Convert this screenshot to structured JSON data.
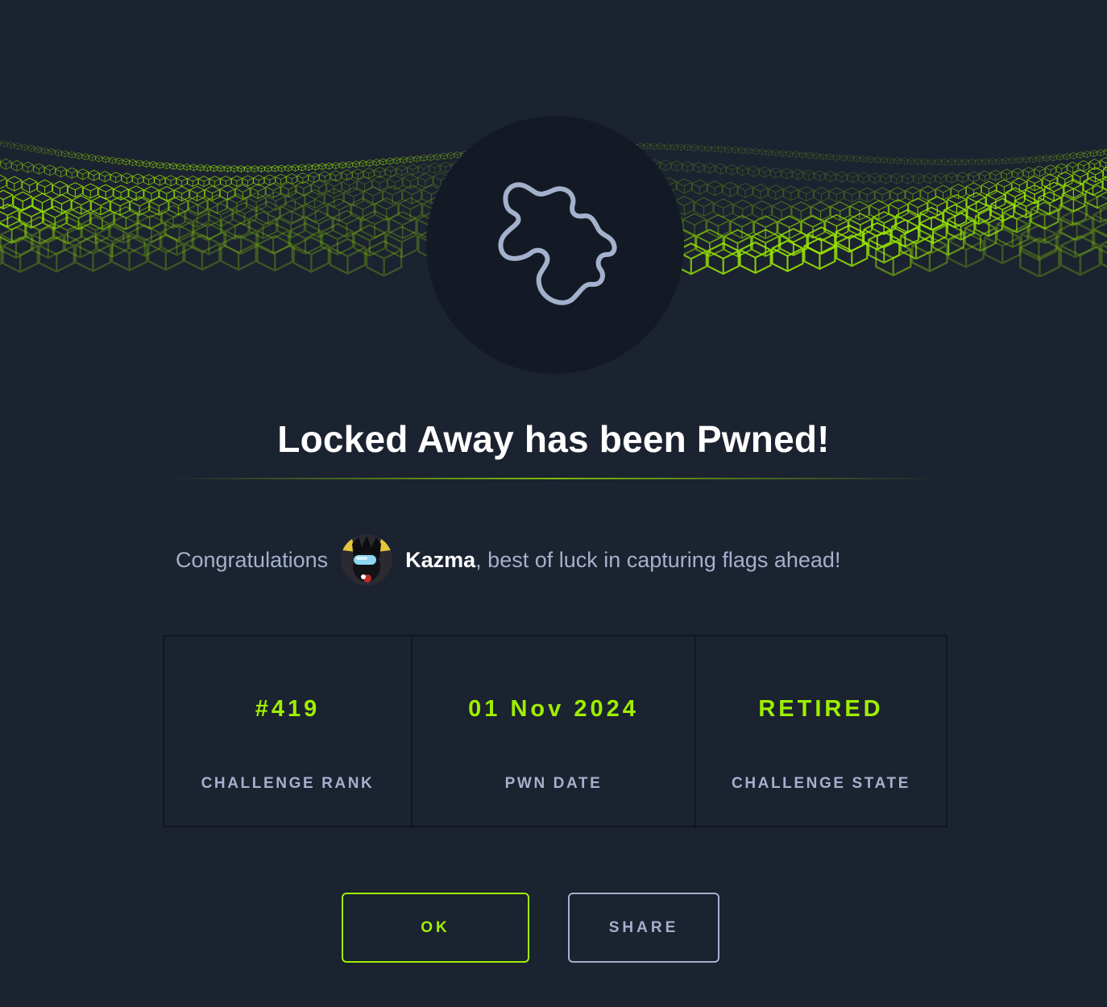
{
  "banner": {
    "image": "green-wireframe-cube-wave",
    "accent_color": "#9fef00"
  },
  "emblem": {
    "icon": "puzzle-piece-icon"
  },
  "title": "Locked Away has been Pwned!",
  "congrats": {
    "prefix": "Congratulations",
    "username": "Kazma",
    "suffix": ", best of luck in capturing flags ahead!",
    "avatar_icon": "user-avatar"
  },
  "stats": [
    {
      "value": "#419",
      "label": "CHALLENGE RANK"
    },
    {
      "value": "01 Nov 2024",
      "label": "PWN DATE"
    },
    {
      "value": "RETIRED",
      "label": "CHALLENGE STATE"
    }
  ],
  "buttons": {
    "ok_label": "OK",
    "share_label": "SHARE"
  },
  "colors": {
    "background": "#1b2230",
    "accent": "#9fef00",
    "muted_text": "#a4b1cd",
    "emblem_bg": "#141a25"
  }
}
